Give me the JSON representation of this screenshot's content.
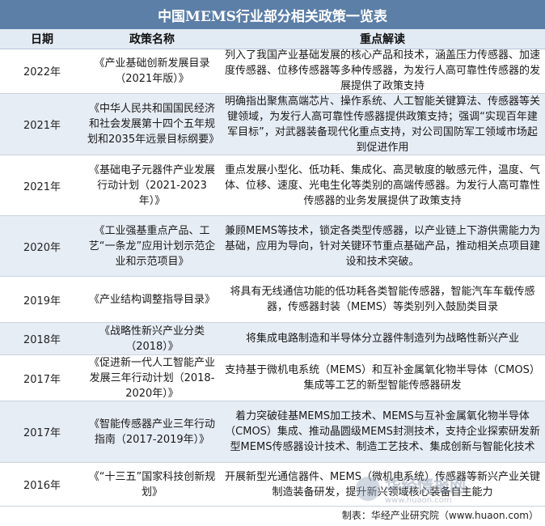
{
  "title": "中国MEMS行业部分相关政策一览表",
  "columns": {
    "date": "日期",
    "name": "政策名称",
    "note": "重点解读"
  },
  "rows": [
    {
      "date": "2022年",
      "name": "《产业基础创新发展目录（2021年版）》",
      "note": "列入了我国产业基础发展的核心产品和技术，涵盖压力传感器、加速度传感器、位移传感器等多种传感器，为发行人高可靠性传感器的发展提供了政策支持"
    },
    {
      "date": "2021年",
      "name": "《中华人民共和国国民经济和社会发展第十四个五年规划和2035年远景目标纲要》",
      "note": "明确指出聚焦高端芯片、操作系统、人工智能关键算法、传感器等关键领域，为发行人高可靠性传感器提供政策支持；强调“实现百年建军目标”，对武器装备现代化重点支持，对公司国防军工领域市场起到促进作用"
    },
    {
      "date": "2021年",
      "name": "《基础电子元器件产业发展行动计划（2021-2023年）》",
      "note": "重点发展小型化、低功耗、集成化、高灵敏度的敏感元件，温度、气体、位移、速度、光电生化等类别的高端传感器。为发行人高可靠性传感器的业务发展提供了政策支持"
    },
    {
      "date": "2020年",
      "name": "《工业强基重点产品、工艺“一条龙”应用计划示范企业和示范项目》",
      "note": "兼顾MEMS等技术，锁定各类型传感器，以产业链上下游供需能力为基础，应用为导向，针对关键环节重点基础产品，推动相关点项目建设和技术突破。"
    },
    {
      "date": "2019年",
      "name": "《产业结构调整指导目录》",
      "note": "将具有无线通信功能的低功耗各类智能传感器，智能汽车车载传感器，传感器封装（MEMS）等类别列入鼓励类目录"
    },
    {
      "date": "2018年",
      "name": "《战略性新兴产业分类（2018）》",
      "note": "将集成电路制造和半导体分立器件制造列为战略性新兴产业"
    },
    {
      "date": "2017年",
      "name": "《促进新一代人工智能产业发展三年行动计划（2018-2020年）》",
      "note": "支持基于微机电系统（MEMS）和互补金属氧化物半导体（CMOS）集成等工艺的新型智能传感器研发"
    },
    {
      "date": "2017年",
      "name": "《智能传感器产业三年行动指南（2017-2019年）》",
      "note": "着力突破硅基MEMS加工技术、MEMS与互补金属氧化物半导体（CMOS）集成、推动晶圆级MEMS封测技术，支持企业探索研发新型MEMS传感器设计技术、制造工艺技术、集成创新与智能化技术"
    },
    {
      "date": "2016年",
      "name": "《“十三五”国家科技创新规划》",
      "note": "开展新型光通信器件、MEMS（微机电系统）传感器等新兴产业关键制造装备研发，提升新兴领域核心装备自主能力"
    }
  ],
  "source": "制表：华经产业研究院（www.huaon.com）",
  "watermark": {
    "text": "华经情报网",
    "sub": "www.huaon.com"
  },
  "colors": {
    "title_bg": "#5c7fa8",
    "header_bg": "#e2eaf3",
    "alt_row_bg": "#e7edf5"
  }
}
